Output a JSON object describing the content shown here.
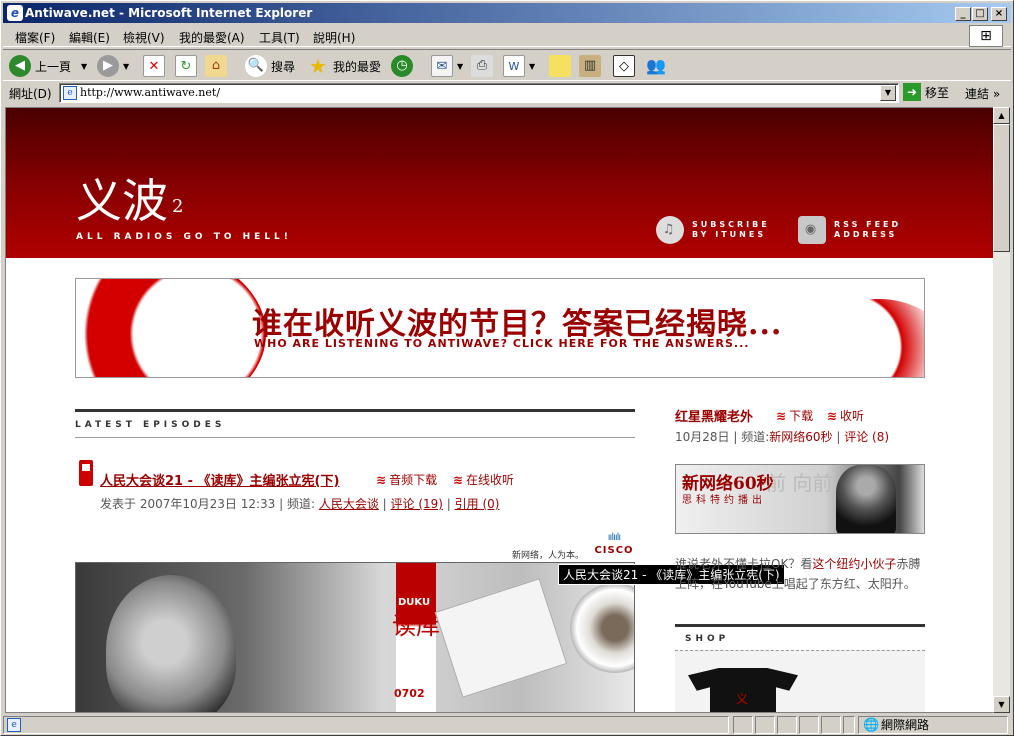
{
  "window": {
    "title": "Antiwave.net - Microsoft Internet Explorer",
    "min_glyph": "_",
    "max_glyph": "□",
    "close_glyph": "×"
  },
  "menu": [
    "檔案(F)",
    "編輯(E)",
    "檢視(V)",
    "我的最愛(A)",
    "工具(T)",
    "說明(H)"
  ],
  "toolbar": {
    "back_label": "上一頁",
    "search_label": "搜尋",
    "favorites_label": "我的最愛"
  },
  "address": {
    "label": "網址(D)",
    "url": "http://www.antiwave.net/",
    "go_label": "移至",
    "links_label": "連結"
  },
  "status": {
    "zone_label": "網際網路"
  },
  "site": {
    "logo": "义波",
    "logo_sup": "2",
    "slogan": "ALL RADIOS GO TO HELL!",
    "subscribe_itunes_1": "SUBSCRIBE",
    "subscribe_itunes_2": "BY ITUNES",
    "rss_1": "RSS FEED",
    "rss_2": "ADDRESS"
  },
  "banner": {
    "headline_cn": "谁在收听义波的节目？答案已经揭晓...",
    "headline_en": "WHO ARE LISTENING TO ANTIWAVE? CLICK HERE FOR THE ANSWERS..."
  },
  "latest": {
    "section_title": "LATEST EPISODES",
    "episode_title": "人民大会谈21 - 《读库》主编张立宪(下)",
    "audio_download": "音频下载",
    "online_listen": "在线收听",
    "posted_prefix": "发表于 2007年10月23日 12:33 | 频道: ",
    "channel": "人民大会谈",
    "sep1": " | ",
    "comments": "评论 (19)",
    "sep2": " | ",
    "trackbacks": "引用 (0)",
    "sponsor_tag": "新网络，人为本。",
    "sponsor_logo": "CISCO",
    "tooltip": "人民大会谈21 - 《读库》主编张立宪(下)",
    "photo_duku_en": "DUKU",
    "photo_duku_cn": "读库",
    "photo_duku_num": "0702"
  },
  "sidebar": {
    "title": "红星黑耀老外",
    "download": "下载",
    "listen": "收听",
    "meta_prefix": "10月28日 | 频道:",
    "channel": "新网络60秒",
    "sep": " | ",
    "comments": "评论 (8)",
    "promo_title": "新网络60秒",
    "promo_sub": "思科特约播出",
    "promo_bg": "前 向前 向",
    "text_1": "谁说老外不懂卡拉OK？看",
    "text_link": "这个纽约小伙子",
    "text_2": "赤膊上阵，在YouTube上唱起了东方红、太阳升。",
    "shop_title": "SHOP",
    "shirt_mark": "义"
  }
}
